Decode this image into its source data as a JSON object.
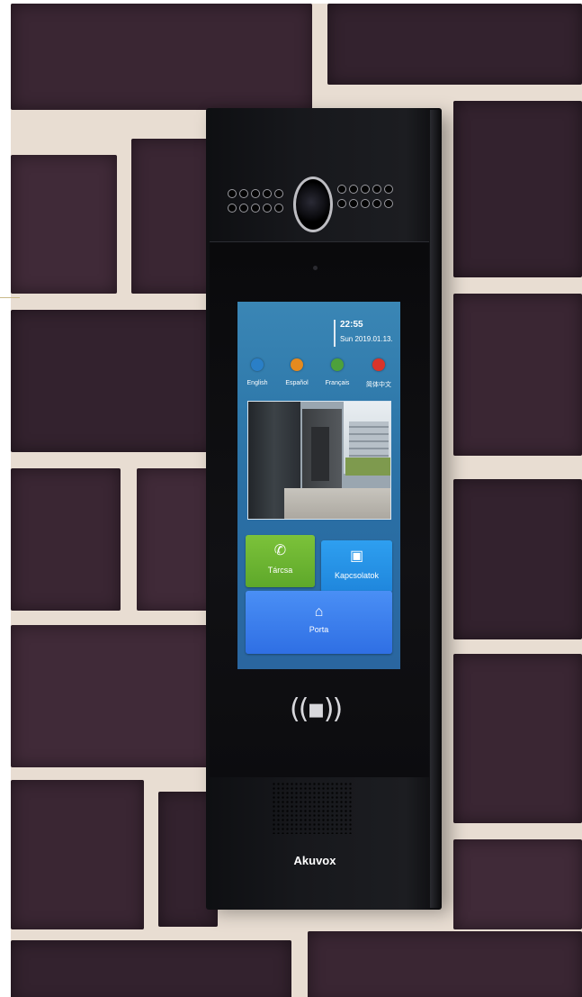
{
  "screen": {
    "time": "22:55",
    "date": "Sun 2019.01.13.",
    "languages": [
      {
        "label": "English",
        "color": "#2a7fc7"
      },
      {
        "label": "Español",
        "color": "#e58a1e"
      },
      {
        "label": "Français",
        "color": "#4da13b"
      },
      {
        "label": "简体中文",
        "color": "#d9342b"
      }
    ],
    "buttons": {
      "dial_label": "Tárcsa",
      "contacts_label": "Kapcsolatok",
      "door_label": "Porta"
    }
  },
  "device": {
    "brand": "Akuvox"
  },
  "icons": {
    "dial": "phone-icon",
    "contacts": "address-book-icon",
    "door": "door-unlock-icon",
    "nfc": "nfc-reader-icon",
    "camera": "camera-lens-icon"
  }
}
